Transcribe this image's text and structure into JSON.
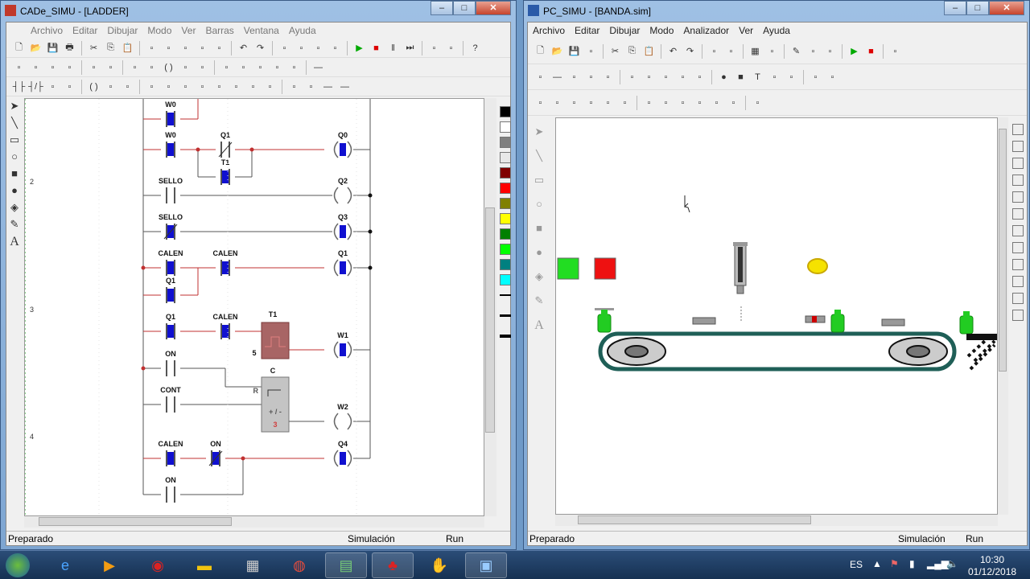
{
  "left_window": {
    "title": "CADe_SIMU - [LADDER]",
    "menu": [
      "Archivo",
      "Editar",
      "Dibujar",
      "Modo",
      "Ver",
      "Barras",
      "Ventana",
      "Ayuda"
    ],
    "toolbar1": [
      "new",
      "open",
      "save",
      "print",
      "|",
      "cut",
      "copy",
      "paste",
      "|",
      "zoom-in",
      "zoom-out",
      "zoom-fit",
      "zoom-page",
      "pan",
      "|",
      "undo",
      "redo",
      "|",
      "align-1",
      "align-2",
      "align-3",
      "align-4",
      "|",
      "run",
      "stop",
      "pause",
      "step",
      "|",
      "window",
      "window2",
      "|",
      "help"
    ],
    "toolbar2": [
      "lamp",
      "fuse",
      "switch",
      "switch3",
      "|",
      "motor",
      "relay",
      "|",
      "contact",
      "contact2",
      "coil",
      "coil2",
      "coil3",
      "|",
      "timer",
      "connect",
      "connect2",
      "counter",
      "block",
      "|",
      "line"
    ],
    "toolbar3": [
      "no-contact",
      "nc-contact",
      "p-contact",
      "n-contact",
      "|",
      "coil",
      "set-coil",
      "reset-coil",
      "|",
      "ton",
      "tof",
      "tp",
      "ctu",
      "ctd",
      "cmp",
      "mov",
      "blk",
      "|",
      "in",
      "out",
      "hline",
      "hline2"
    ],
    "row_numbers": [
      "2",
      "3",
      "4"
    ],
    "ladder_labels": {
      "w0a": "W0",
      "w0b": "W0",
      "q1nc": "Q1",
      "t1c": "T1",
      "q0": "Q0",
      "sello1": "SELLO",
      "q2": "Q2",
      "sello2": "SELLO",
      "q3": "Q3",
      "calen1": "CALEN",
      "calen2": "CALEN",
      "q1coil": "Q1",
      "q1b": "Q1",
      "q1c": "Q1",
      "calen3": "CALEN",
      "t1": "T1",
      "t1preset": "5",
      "w1": "W1",
      "on1": "ON",
      "c": "C",
      "cr": "R",
      "cont": "CONT",
      "cpm": "+ / -",
      "cval": "3",
      "w2": "W2",
      "calen4": "CALEN",
      "on2": "ON",
      "q4": "Q4",
      "on3": "ON"
    },
    "status": {
      "left": "Preparado",
      "mode": "Simulación",
      "state": "Run"
    },
    "palette_colors": [
      "#000000",
      "#ffffff",
      "#808080",
      "#e8e8e8",
      "#800000",
      "#ff0000",
      "#808000",
      "#ffff00",
      "#008000",
      "#00ff00",
      "#008080",
      "#00ffff"
    ]
  },
  "right_window": {
    "title": "PC_SIMU - [BANDA.sim]",
    "menu": [
      "Archivo",
      "Editar",
      "Dibujar",
      "Modo",
      "Analizador",
      "Ver",
      "Ayuda"
    ],
    "toolbar1": [
      "new",
      "open",
      "save",
      "print-setup",
      "|",
      "cut",
      "copy",
      "paste",
      "|",
      "undo",
      "redo",
      "|",
      "group",
      "ungroup",
      "|",
      "grid",
      "snap",
      "|",
      "pencil",
      "monitor",
      "device",
      "|",
      "run",
      "stop",
      "|",
      "io"
    ],
    "toolbar2": [
      "sensor",
      "line",
      "arc",
      "cross",
      "grid-block",
      "|",
      "valve",
      "rect",
      "rect2",
      "rect3",
      "rect4",
      "|",
      "circle",
      "square",
      "text",
      "piston",
      "speaker",
      "|",
      "bar",
      "dots"
    ],
    "toolbar3": [
      "motor",
      "tank",
      "cylinder",
      "cylinder2",
      "valve2",
      "tower",
      "|",
      "display",
      "bottle",
      "valve3",
      "block",
      "plant",
      "conveyor",
      "|",
      "io-module"
    ],
    "status": {
      "left": "Preparado",
      "mode": "Simulación",
      "state": "Run"
    },
    "sim": {
      "start_color": "#22dd22",
      "stop_color": "#ee1111",
      "lamp_color": "#f5e200",
      "bottle_color": "#22cc22"
    }
  },
  "taskbar": {
    "apps": [
      "start",
      "internet-explorer",
      "media-player",
      "app-red",
      "file-explorer",
      "network-app",
      "chrome",
      "app-green",
      "cade-simu",
      "app-orange",
      "pc-simu"
    ],
    "language": "ES",
    "time": "10:30",
    "date": "01/12/2018"
  }
}
